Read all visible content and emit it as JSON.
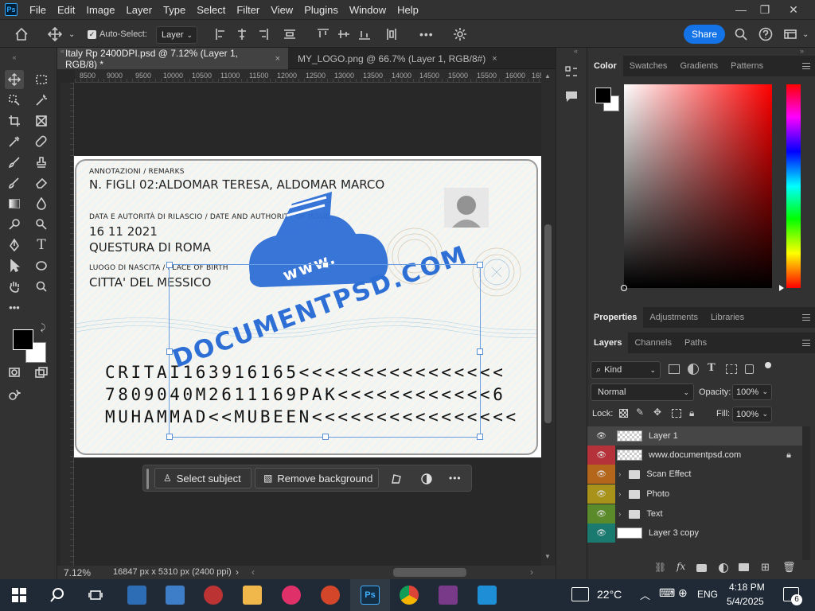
{
  "app": {
    "logo": "Ps"
  },
  "menu": [
    "File",
    "Edit",
    "Image",
    "Layer",
    "Type",
    "Select",
    "Filter",
    "View",
    "Plugins",
    "Window",
    "Help"
  ],
  "options_bar": {
    "auto_select_label": "Auto-Select:",
    "auto_select_checked": true,
    "auto_select_target": "Layer",
    "share_label": "Share"
  },
  "tabs": [
    {
      "title": "Italy Rp 2400DPI.psd @ 7.12% (Layer 1, RGB/8) *",
      "close": "×",
      "active": true
    },
    {
      "title": "MY_LOGO.png @ 66.7% (Layer 1, RGB/8#)",
      "close": "×",
      "active": false
    }
  ],
  "ruler_ticks": [
    "8500",
    "9000",
    "9500",
    "10000",
    "10500",
    "11000",
    "11500",
    "12000",
    "12500",
    "13000",
    "13500",
    "14000",
    "14500",
    "15000",
    "15500",
    "16000",
    "165"
  ],
  "card": {
    "remarks_label": "ANNOTAZIONI / REMARKS",
    "remarks_value": "N. FIGLI 02:ALDOMAR TERESA, ALDOMAR MARCO",
    "issue_label": "DATA E AUTORITÀ DI RILASCIO / DATE AND AUTHORITY OF ISSUE",
    "issue_date": "16 11 2021",
    "issue_authority": "QUESTURA DI ROMA",
    "birth_label": "LUOGO DI NASCITA / PLACE OF BIRTH",
    "birth_value": "CITTA' DEL MESSICO",
    "mrz": [
      "CRITAI163916165<<<<<<<<<<<<<<<<",
      "7809040M2611169PAK<<<<<<<<<<<<6",
      "MUHAMMAD<<MUBEEN<<<<<<<<<<<<<<<<"
    ],
    "watermark_www": "www.",
    "watermark_domain": "DOCUMENTPSD.COM"
  },
  "context_bar": {
    "select_subject": "Select subject",
    "remove_background": "Remove background",
    "more": "•••"
  },
  "status": {
    "zoom": "7.12%",
    "doc_info": "16847 px x 5310 px (2400 ppi)"
  },
  "color_panel": {
    "tabs": [
      "Color",
      "Swatches",
      "Gradients",
      "Patterns"
    ],
    "active": "Color"
  },
  "properties_panel": {
    "tabs": [
      "Properties",
      "Adjustments",
      "Libraries"
    ],
    "active": "Properties"
  },
  "layers_panel": {
    "tabs": [
      "Layers",
      "Channels",
      "Paths"
    ],
    "active": "Layers",
    "filter_kind": "Kind",
    "blend_mode": "Normal",
    "opacity_label": "Opacity:",
    "opacity": "100%",
    "lock_label": "Lock:",
    "fill_label": "Fill:",
    "fill": "100%",
    "layers": [
      {
        "name": "Layer 1",
        "type": "layer",
        "color": "#3a3a3a",
        "selected": true
      },
      {
        "name": "www.documentpsd.com",
        "type": "layer",
        "color": "#b5323a",
        "locked": true
      },
      {
        "name": "Scan Effect",
        "type": "group",
        "color": "#b4661a"
      },
      {
        "name": "Photo",
        "type": "group",
        "color": "#a8921a"
      },
      {
        "name": "Text",
        "type": "group",
        "color": "#5a8a2a"
      },
      {
        "name": "Layer 3 copy",
        "type": "layer",
        "color": "#1a7a70"
      }
    ]
  },
  "taskbar": {
    "weather": "22°C",
    "language": "ENG",
    "time": "4:18 PM",
    "date": "5/4/2025",
    "notifications": "6"
  }
}
